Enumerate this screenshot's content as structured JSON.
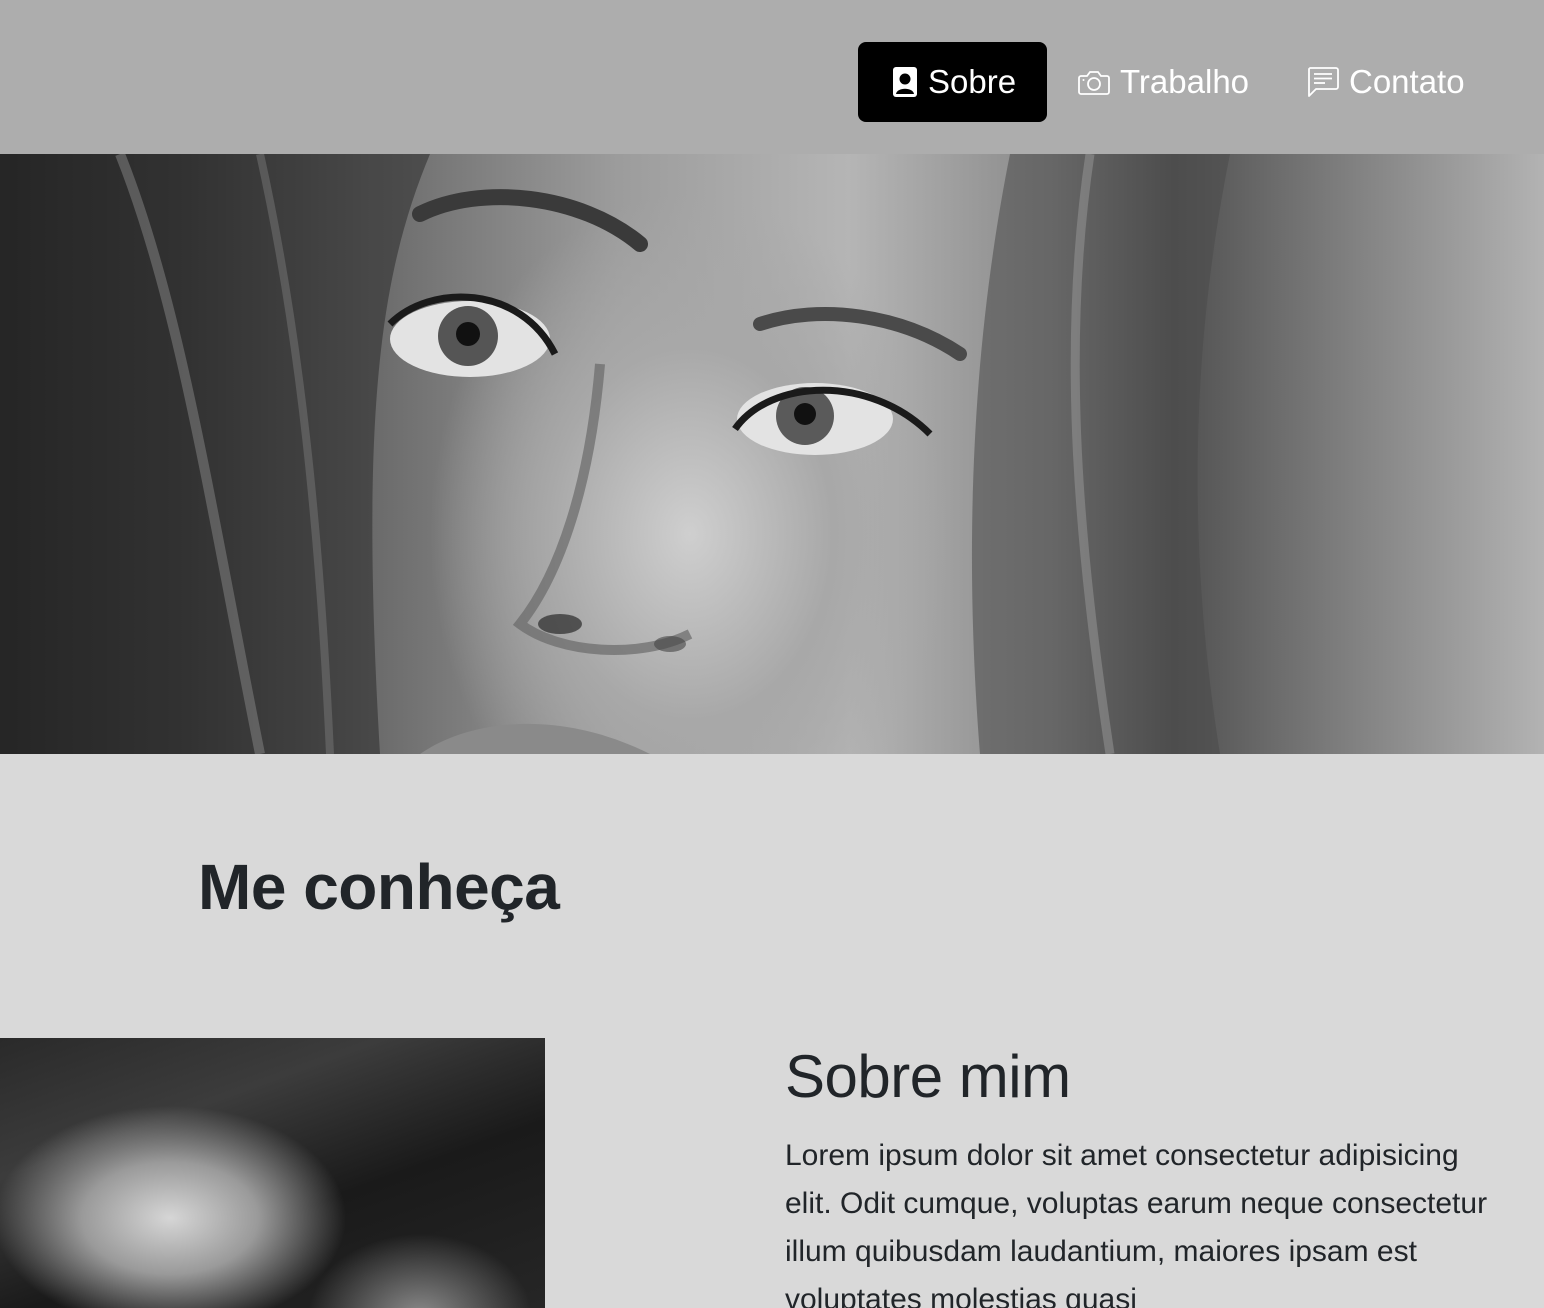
{
  "navbar": {
    "items": [
      {
        "label": "Sobre",
        "icon": "person-badge-icon",
        "active": true
      },
      {
        "label": "Trabalho",
        "icon": "camera-icon",
        "active": false
      },
      {
        "label": "Contato",
        "icon": "chat-left-text-icon",
        "active": false
      }
    ]
  },
  "hero": {
    "image": "portrait-photo"
  },
  "section": {
    "title": "Me conheça",
    "about_title": "Sobre mim",
    "about_text": "Lorem ipsum dolor sit amet consectetur adipisicing elit. Odit cumque, voluptas earum neque consectetur illum quibusdam laudantium, maiores ipsam est voluptates molestias quasi"
  },
  "colors": {
    "navbar_bg": "#adadad",
    "active_bg": "#000000",
    "page_bg": "#d9d9d9",
    "text": "#212529"
  }
}
